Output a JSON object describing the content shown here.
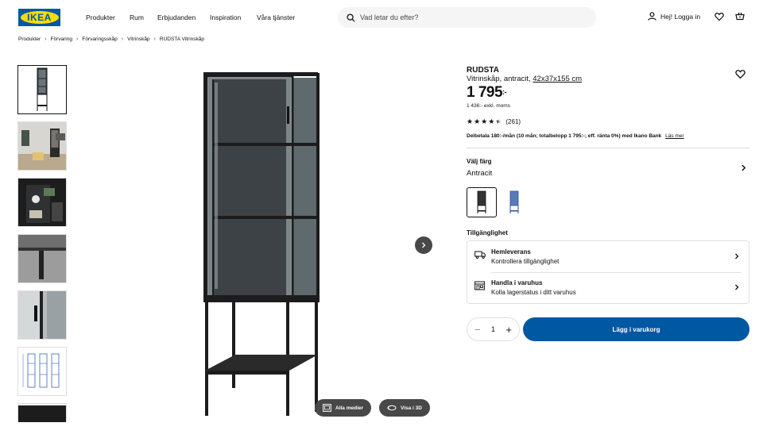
{
  "header": {
    "logo_text": "IKEA",
    "nav": [
      "Produkter",
      "Rum",
      "Erbjudanden",
      "Inspiration",
      "Våra tjänster"
    ],
    "search_placeholder": "Vad letar du efter?",
    "login_label": "Hej! Logga in",
    "icons": [
      "search-icon",
      "person-icon",
      "heart-icon",
      "cart-icon"
    ]
  },
  "breadcrumb": [
    "Produkter",
    "Förvaring",
    "Förvaringsskåp",
    "Vitrinskåp",
    "RUDSTA Vitrinskåp"
  ],
  "media": {
    "all_media_label": "Alla medier",
    "view_3d_label": "Visa i 3D"
  },
  "product": {
    "name": "RUDSTA",
    "description": "Vitrinskåp, antracit,",
    "measure": "42x37x155 cm",
    "price": "1 795",
    "price_suffix": ":-",
    "price_ex_vat": "1 436:- exkl. moms",
    "rating_stars": 4.5,
    "rating_count": "(261)",
    "finance_text": "Delbetala 180:-/mån (10 mån; totalbelopp 1 795:-; eff. ränta 0%) med Ikano Bank",
    "finance_link": "Läs mer"
  },
  "color": {
    "label": "Välj färg",
    "value": "Antracit",
    "swatches": [
      {
        "name": "antracit",
        "color": "#1e1e1e",
        "selected": true
      },
      {
        "name": "blue",
        "color": "#2b4f9c",
        "selected": false
      }
    ]
  },
  "availability": {
    "label": "Tillgänglighet",
    "rows": [
      {
        "title": "Hemleverans",
        "subtitle": "Kontrollera tillgänglighet",
        "icon": "truck-icon"
      },
      {
        "title": "Handla i varuhus",
        "subtitle": "Kolla lagerstatus i ditt varuhus",
        "icon": "store-icon"
      }
    ]
  },
  "cart": {
    "quantity": "1",
    "add_label": "Lägg i varukorg"
  },
  "colors": {
    "brand_blue": "#0058a3",
    "brand_yellow": "#ffdb00",
    "dark_pill": "#484848"
  }
}
